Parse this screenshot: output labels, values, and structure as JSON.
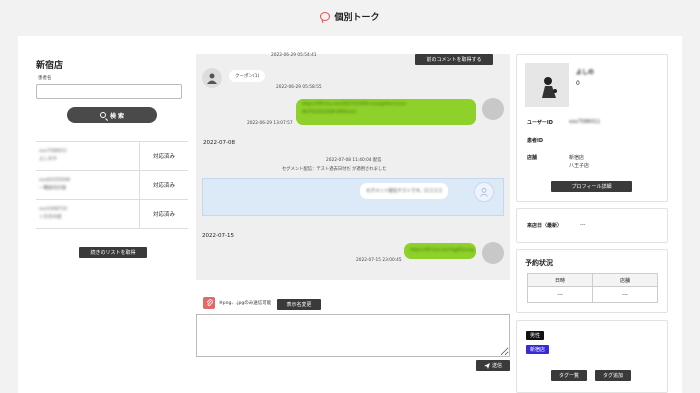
{
  "header": {
    "title": "個別トーク"
  },
  "left": {
    "store_name": "新宿店",
    "field_label": "患者名",
    "search_placeholder": "",
    "search_button": "検 索",
    "users": [
      {
        "line1": "xxx7586011",
        "line2": "よしのす",
        "status": "対応済み"
      },
      {
        "line1": "xxxb5255048",
        "line2": "一種族同計器",
        "status": "対応済み"
      },
      {
        "line1": "xxx5308710",
        "line2": "くの方の宿",
        "status": "対応済み"
      }
    ],
    "next_list_button": "続きのリストを取得"
  },
  "chat": {
    "prev_button": "前のコメントを取得する",
    "top_timestamp": "2022-06-29 05:54:41",
    "msg1_text": "クーポン(1)",
    "msg1_timestamp": "2022-06-29 05:58:55",
    "msg2_lines": [
      "https://liff.line.me/1657123456-xxxxgsf/xx?xxxx",
      "9b7f12223328f-4f00xxxx"
    ],
    "msg2_timestamp": "2022-06-29 13:07:57",
    "date1": "2022-07-08",
    "segment_timestamp": "2022-07-08 11:40:04 配信",
    "segment_note": "セグメント配信：テスト過去日付だ が適用されました",
    "segment_message": "セグメント配信テストです。ロコココ",
    "date2": "2022-07-15",
    "msg3_text": "https://liff.line.me/7ggt5jvxxg",
    "msg3_timestamp": "2022-07-15 23:00:45"
  },
  "input": {
    "file_hint": "※png、.jpgのみ送信可能",
    "rename_button": "表示名変更",
    "send_button": "送信",
    "message_placeholder": ""
  },
  "profile": {
    "name": "よしの",
    "count": "0",
    "user_id_label": "ユーザーID",
    "user_id_value": "xxx7586011",
    "patient_id_label": "患者ID",
    "patient_id_value": "",
    "store_label": "店舗",
    "store_values": [
      "新宿店",
      "八王子店"
    ],
    "detail_button": "プロフィール詳細"
  },
  "visit": {
    "label": "来店日（最新）",
    "value": "---"
  },
  "reserve": {
    "title": "予約状況",
    "col_date": "日時",
    "col_store": "店舗",
    "row_date": "---",
    "row_store": "---"
  },
  "tags": {
    "badges": [
      "男性",
      "新宿店"
    ],
    "list_button": "タグ一覧",
    "add_button": "タグ追加",
    "colors": {
      "male": "#111111",
      "store": "#3a2ad6"
    }
  },
  "colors": {
    "accent_green": "#8ed12a",
    "segment_band": "#dce9f7",
    "button_dark": "#3a3a3a",
    "clip_red": "#e06a6a"
  }
}
